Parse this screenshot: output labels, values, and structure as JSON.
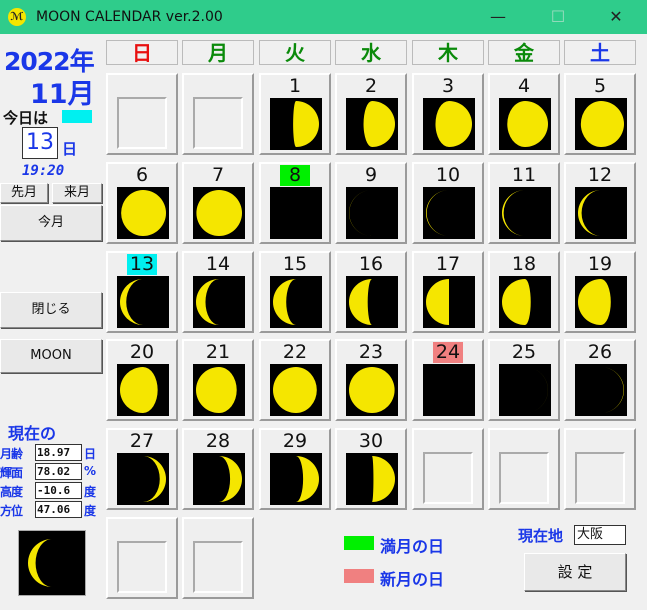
{
  "window": {
    "title": "MOON CALENDAR ver.2.00",
    "app_icon_text": "ℳ"
  },
  "header": {
    "year": "2022年",
    "month": "11月"
  },
  "today": {
    "label": "今日は",
    "day": "13",
    "day_unit": "日",
    "time": "19:20",
    "highlight_color": "#00f0f0"
  },
  "nav": {
    "prev_month": "先月",
    "next_month": "来月",
    "this_month": "今月",
    "close": "閉じる",
    "moon": "MOON"
  },
  "current": {
    "title": "現在の",
    "stats": [
      {
        "label": "月齢",
        "value": "18.97",
        "unit": "日"
      },
      {
        "label": "輝面",
        "value": "78.02",
        "unit": "%"
      },
      {
        "label": "高度",
        "value": "-10.6",
        "unit": "度"
      },
      {
        "label": "方位",
        "value": "47.06",
        "unit": "度"
      }
    ],
    "illumination": 0.78
  },
  "weekdays": [
    {
      "label": "日",
      "color": "#e81010"
    },
    {
      "label": "月",
      "color": "#0a8a0a"
    },
    {
      "label": "火",
      "color": "#0a8a0a"
    },
    {
      "label": "水",
      "color": "#0a8a0a"
    },
    {
      "label": "木",
      "color": "#0a8a0a"
    },
    {
      "label": "金",
      "color": "#0a8a0a"
    },
    {
      "label": "土",
      "color": "#1a37e8"
    }
  ],
  "calendar": {
    "weeks": [
      [
        null,
        null,
        {
          "day": "1",
          "phase": 0.27
        },
        {
          "day": "2",
          "phase": 0.31
        },
        {
          "day": "3",
          "phase": 0.35
        },
        {
          "day": "4",
          "phase": 0.39
        },
        {
          "day": "5",
          "phase": 0.42
        }
      ],
      [
        {
          "day": "6",
          "phase": 0.45
        },
        {
          "day": "7",
          "phase": 0.47
        },
        {
          "day": "8",
          "phase": 0.5,
          "mark": "full"
        },
        {
          "day": "9",
          "phase": 0.52
        },
        {
          "day": "10",
          "phase": 0.54
        },
        {
          "day": "11",
          "phase": 0.56
        },
        {
          "day": "12",
          "phase": 0.59
        }
      ],
      [
        {
          "day": "13",
          "phase": 0.62,
          "mark": "today"
        },
        {
          "day": "14",
          "phase": 0.65
        },
        {
          "day": "15",
          "phase": 0.68
        },
        {
          "day": "16",
          "phase": 0.72
        },
        {
          "day": "17",
          "phase": 0.75
        },
        {
          "day": "18",
          "phase": 0.79
        },
        {
          "day": "19",
          "phase": 0.82
        }
      ],
      [
        {
          "day": "20",
          "phase": 0.86
        },
        {
          "day": "21",
          "phase": 0.89
        },
        {
          "day": "22",
          "phase": 0.93
        },
        {
          "day": "23",
          "phase": 0.97
        },
        {
          "day": "24",
          "phase": 0.0,
          "mark": "new"
        },
        {
          "day": "25",
          "phase": 0.01
        },
        {
          "day": "26",
          "phase": 0.03
        }
      ],
      [
        {
          "day": "27",
          "phase": 0.12
        },
        {
          "day": "28",
          "phase": 0.17
        },
        {
          "day": "29",
          "phase": 0.2
        },
        {
          "day": "30",
          "phase": 0.24
        },
        null,
        null,
        null
      ],
      [
        null,
        null
      ]
    ]
  },
  "legend": {
    "full_label": "満月の日",
    "full_color": "#00f000",
    "new_label": "新月の日",
    "new_color": "#f08080"
  },
  "location": {
    "label": "現在地",
    "value": "大阪"
  },
  "settings_label": "設 定",
  "colors": {
    "moon": "#f5e600",
    "shadow": "#000000",
    "accent": "#1a37e8",
    "titlebar": "#2fcc8b"
  }
}
